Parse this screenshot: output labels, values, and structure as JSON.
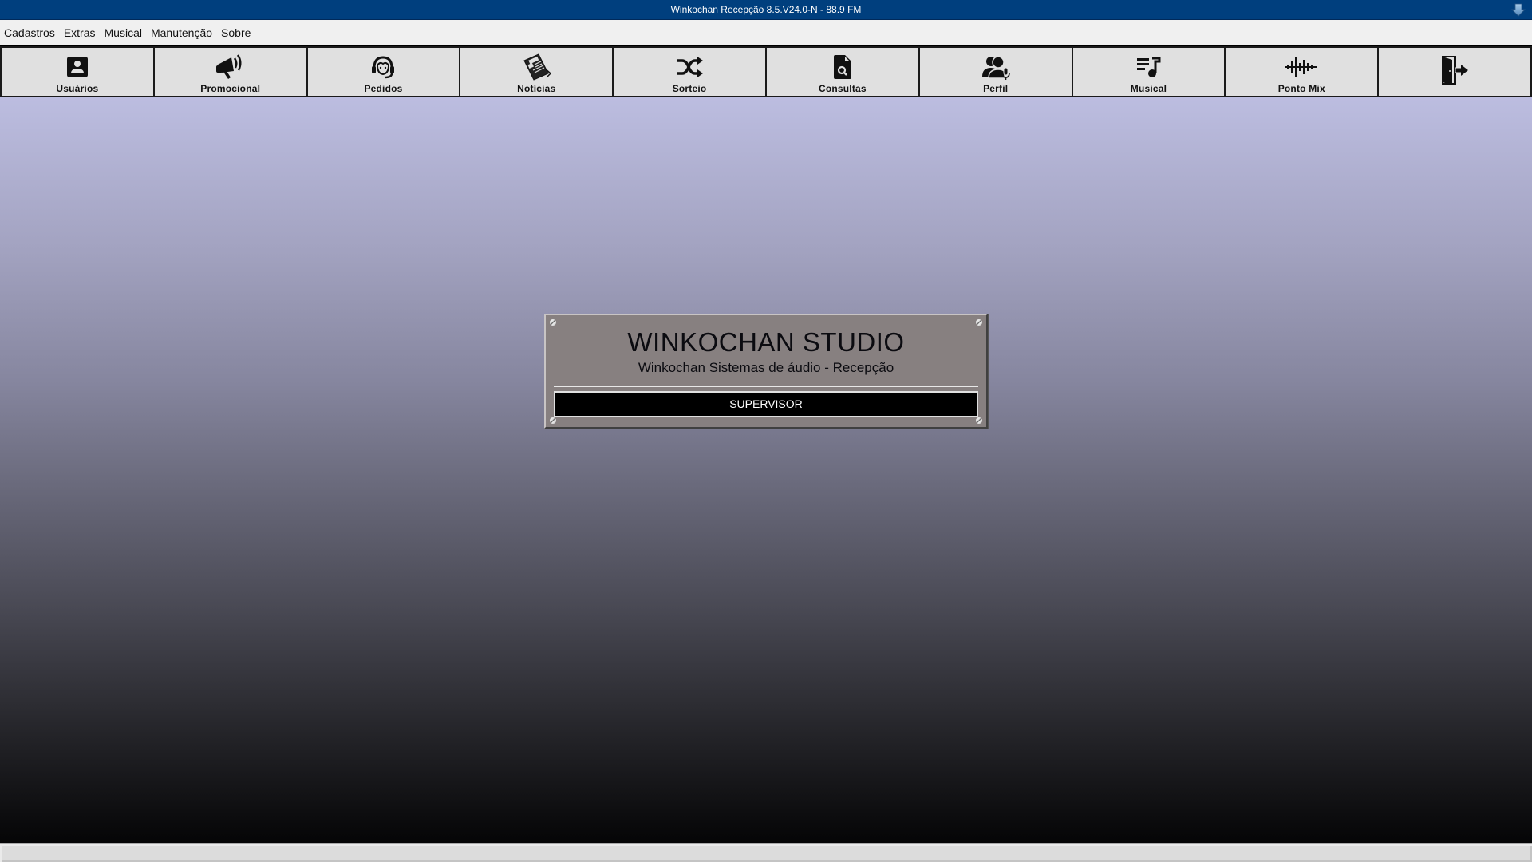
{
  "window": {
    "title": "Winkochan Recepção 8.5.V24.0-N - 88.9 FM",
    "download_icon": "arrow-down-icon"
  },
  "menubar": {
    "items": [
      {
        "label": "Cadastros",
        "mnemonic": "C",
        "rest": "adastros"
      },
      {
        "label": "Extras",
        "mnemonic": "",
        "rest": "Extras"
      },
      {
        "label": "Musical",
        "mnemonic": "",
        "rest": "Musical"
      },
      {
        "label": "Manutenção",
        "mnemonic": "",
        "rest": "Manutenção"
      },
      {
        "label": "Sobre",
        "mnemonic": "S",
        "rest": "obre"
      }
    ]
  },
  "toolbar": {
    "buttons": [
      {
        "label": "Usuários",
        "icon": "user-card-icon"
      },
      {
        "label": "Promocional",
        "icon": "megaphone-icon"
      },
      {
        "label": "Pedidos",
        "icon": "headset-icon"
      },
      {
        "label": "Notícias",
        "icon": "newspaper-icon"
      },
      {
        "label": "Sorteio",
        "icon": "shuffle-icon"
      },
      {
        "label": "Consultas",
        "icon": "file-search-icon"
      },
      {
        "label": "Perfil",
        "icon": "users-mic-icon"
      },
      {
        "label": "Musical",
        "icon": "playlist-music-icon"
      },
      {
        "label": "Ponto Mix",
        "icon": "waveform-icon"
      },
      {
        "label": "",
        "icon": "exit-door-icon"
      }
    ]
  },
  "panel": {
    "title": "WINKOCHAN STUDIO",
    "subtitle": "Winkochan Sistemas de áudio - Recepção",
    "user_level": "SUPERVISOR"
  },
  "colors": {
    "titlebar": "#003f7e",
    "menubar": "#f0f0f0",
    "toolbar_button": "#e0e0e0",
    "panel": "#878080",
    "gradient_top": "#bcbde0",
    "gradient_bottom": "#050506"
  }
}
